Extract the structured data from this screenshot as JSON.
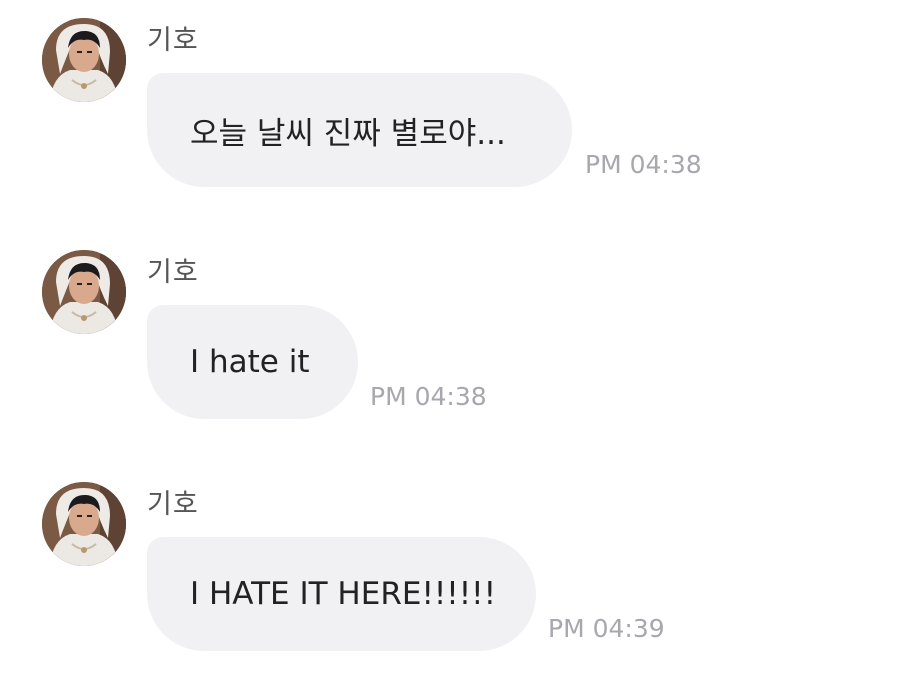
{
  "conversation": {
    "messages": [
      {
        "sender": "기호",
        "avatar_icon": "profile-photo",
        "text": "오늘 날씨 진짜 별로야...",
        "time": "PM 04:38"
      },
      {
        "sender": "기호",
        "avatar_icon": "profile-photo",
        "text": "I hate it",
        "time": "PM 04:38"
      },
      {
        "sender": "기호",
        "avatar_icon": "profile-photo",
        "text": "I HATE IT HERE!!!!!!",
        "time": "PM 04:39"
      }
    ]
  },
  "colors": {
    "bubble": "#f1f1f4",
    "message_text": "#222222",
    "sender_text": "#555555",
    "timestamp_text": "#a7a7ad",
    "background": "#ffffff"
  }
}
